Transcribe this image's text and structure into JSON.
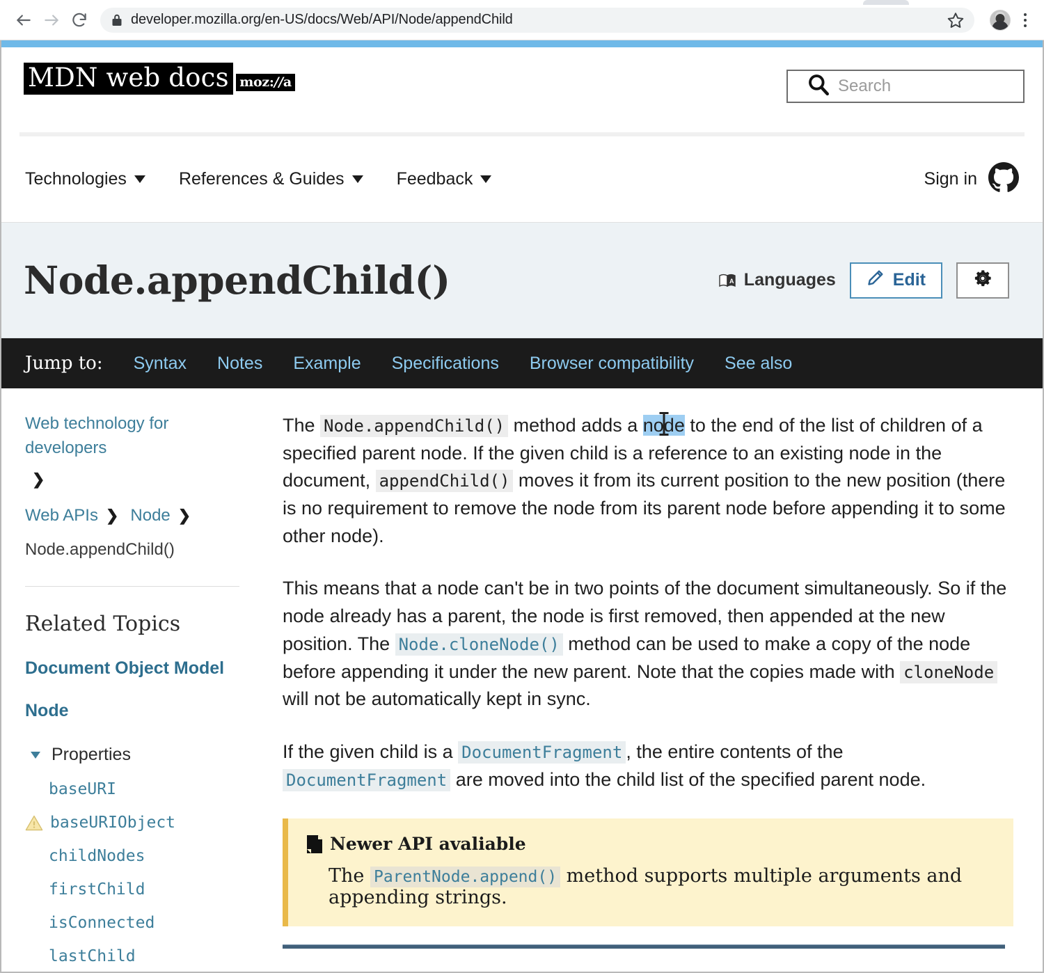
{
  "browser": {
    "url": "developer.mozilla.org/en-US/docs/Web/API/Node/appendChild",
    "back_label": "Back",
    "forward_label": "Forward",
    "reload_label": "Reload",
    "bookmark_label": "Bookmark this tab",
    "profile_label": "Profile",
    "menu_label": "Customize and control Chrome"
  },
  "masthead": {
    "logo_main": "MDN web docs",
    "logo_sub_pre": "moz:",
    "logo_sub_slash": "//",
    "logo_sub_post": "a",
    "search_placeholder": "Search"
  },
  "mainnav": {
    "items": [
      {
        "label": "Technologies"
      },
      {
        "label": "References & Guides"
      },
      {
        "label": "Feedback"
      }
    ],
    "signin_label": "Sign in",
    "github_label": "GitHub"
  },
  "titleband": {
    "title": "Node.appendChild()",
    "languages_label": "Languages",
    "edit_label": "Edit",
    "settings_label": "Settings"
  },
  "jumpbar": {
    "label": "Jump to:",
    "links": [
      "Syntax",
      "Notes",
      "Example",
      "Specifications",
      "Browser compatibility",
      "See also"
    ]
  },
  "sidebar": {
    "breadcrumb_top": "Web technology for developers",
    "chevron": "❯",
    "crumbs": [
      "Web APIs",
      "Node"
    ],
    "current": "Node.appendChild()",
    "related_title": "Related Topics",
    "related_links": [
      "Document Object Model",
      "Node"
    ],
    "group_label": "Properties",
    "properties": [
      {
        "name": "baseURI",
        "warning": false
      },
      {
        "name": "baseURIObject",
        "warning": true
      },
      {
        "name": "childNodes",
        "warning": false
      },
      {
        "name": "firstChild",
        "warning": false
      },
      {
        "name": "isConnected",
        "warning": false
      },
      {
        "name": "lastChild",
        "warning": false
      }
    ]
  },
  "article": {
    "p1": {
      "a": "The ",
      "code1": "Node.appendChild()",
      "b": " method adds a ",
      "selected": "node",
      "c": " to the end of the list of children of a specified parent node. If the given child is a reference to an existing node in the document, ",
      "code2": "appendChild()",
      "d": " moves it from its current position to the new position (there is no requirement to remove the node from its parent node before appending it to some other node)."
    },
    "p2": {
      "a": "This means that a node can't be in two points of the document simultaneously. So if the node already has a parent, the node is first removed, then appended at the new position. The ",
      "code1": "Node.cloneNode()",
      "b": " method can be used to make a copy of the node before appending it under the new parent. Note that the copies made with ",
      "code2": "cloneNode",
      "c": " will not be automatically kept in sync."
    },
    "p3": {
      "a": "If the given child is a ",
      "code1": "DocumentFragment",
      "b": ", the entire contents of the ",
      "code2": "DocumentFragment",
      "c": " are moved into the child list of the specified parent node."
    },
    "note": {
      "title": "Newer API avaliable",
      "a": "The ",
      "code1": "ParentNode.append()",
      "b": " method supports multiple arguments and appending strings."
    }
  }
}
